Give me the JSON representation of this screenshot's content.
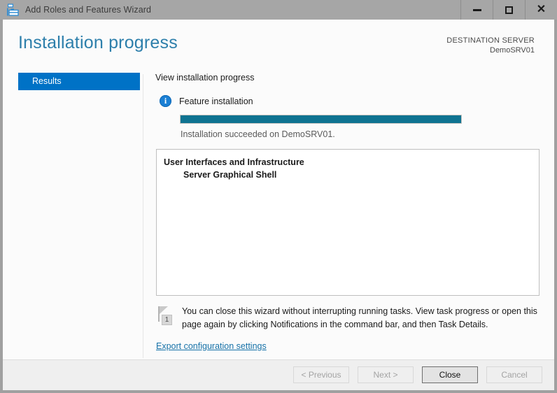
{
  "window": {
    "title": "Add Roles and Features Wizard",
    "icon": "server-wizard-icon",
    "controls": {
      "minimize": "minimize-icon",
      "maximize": "maximize-icon",
      "close": "✕"
    }
  },
  "header": {
    "page_title": "Installation progress",
    "destination_label": "DESTINATION SERVER",
    "destination_server": "DemoSRV01"
  },
  "sidebar": {
    "items": [
      {
        "label": "Results",
        "selected": true
      }
    ]
  },
  "main": {
    "heading": "View installation progress",
    "feature": {
      "icon": "info-icon",
      "glyph": "i",
      "label": "Feature installation"
    },
    "progress": {
      "percent": 100,
      "status": "Installation succeeded on DemoSRV01."
    },
    "results": [
      {
        "text": "User Interfaces and Infrastructure",
        "indent": 0
      },
      {
        "text": "Server Graphical Shell",
        "indent": 1
      }
    ],
    "note": {
      "icon": "notification-flag-icon",
      "badge": "1",
      "text": "You can close this wizard without interrupting running tasks. View task progress or open this page again by clicking Notifications in the command bar, and then Task Details."
    },
    "export_link": "Export configuration settings"
  },
  "footer": {
    "buttons": [
      {
        "label": "< Previous",
        "state": "disabled"
      },
      {
        "label": "Next >",
        "state": "disabled"
      },
      {
        "label": "Close",
        "state": "default"
      },
      {
        "label": "Cancel",
        "state": "disabled"
      }
    ]
  },
  "colors": {
    "accent_blue": "#0072c6",
    "title_blue": "#2d7fab",
    "progress_teal": "#0f7391",
    "info_blue": "#1a7fd4",
    "link_blue": "#1772a8"
  }
}
